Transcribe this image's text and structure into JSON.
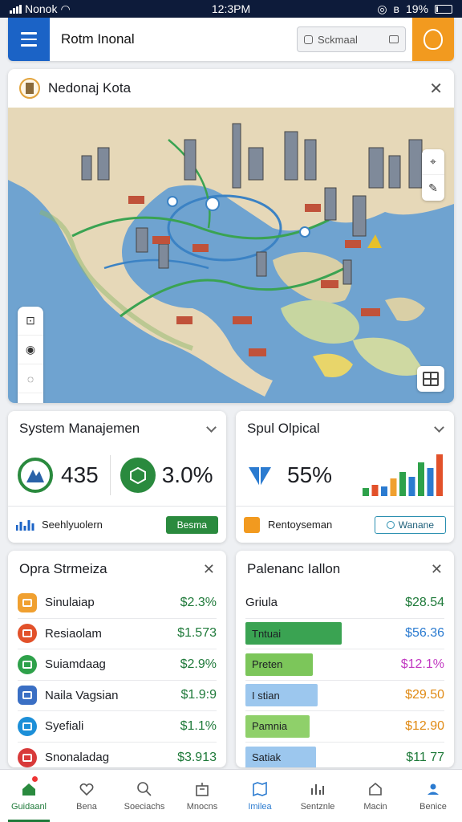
{
  "status": {
    "carrier": "Nonok",
    "time": "12:3PM",
    "battery": "19%"
  },
  "app": {
    "title": "Rotm Inonal",
    "search_placeholder": "Sckmaal"
  },
  "map": {
    "title": "Nedonaj Kota"
  },
  "colors": {
    "primary": "#1b63c6",
    "accent": "#f29a1f",
    "green": "#1f7a3a",
    "water": "#6fa3d0",
    "land": "#e8dcc0"
  },
  "card_system": {
    "title": "System Manajemen",
    "stat1": "435",
    "stat2": "3.0%",
    "footer_label": "Seehlyuolern",
    "footer_button": "Besma"
  },
  "card_spul": {
    "title": "Spul Olpical",
    "stat": "55%",
    "footer_label": "Rentoyseman",
    "footer_button": "Wanane",
    "chart_values": [
      10,
      14,
      12,
      22,
      30,
      24,
      42,
      35,
      52
    ]
  },
  "list_left": {
    "title": "Opra Strmeiza",
    "items": [
      {
        "label": "Sinulaiap",
        "value": "$2.3%",
        "icon": "folder-icon",
        "color": "#f0a030"
      },
      {
        "label": "Resiaolam",
        "value": "$1.573",
        "icon": "gear-icon",
        "color": "#e2512a"
      },
      {
        "label": "Suiamdaag",
        "value": "$2.9%",
        "icon": "grid-icon",
        "color": "#2ea14a"
      },
      {
        "label": "Naila Vagsian",
        "value": "$1.9:9",
        "icon": "box-icon",
        "color": "#3a6fc4"
      },
      {
        "label": "Syefiali",
        "value": "$1.1%",
        "icon": "globe-icon",
        "color": "#1c8fd8"
      },
      {
        "label": "Snonaladag",
        "value": "$3.913",
        "icon": "document-icon",
        "color": "#d83a3a"
      }
    ]
  },
  "list_right": {
    "title": "Palenanc Iallon",
    "header_label": "Griula",
    "header_value": "$28.54",
    "items": [
      {
        "label": "Tntuai",
        "value": "$56.36",
        "fill": 0.6,
        "bar_color": "#3aa352",
        "value_color": "#2b7bd0"
      },
      {
        "label": "Preten",
        "value": "$12.1%",
        "fill": 0.42,
        "bar_color": "#7cc65a",
        "value_color": "#c23ac2"
      },
      {
        "label": "I stian",
        "value": "$29.50",
        "fill": 0.45,
        "bar_color": "#9cc7ee",
        "value_color": "#e08a14"
      },
      {
        "label": "Pamnia",
        "value": "$12.90",
        "fill": 0.4,
        "bar_color": "#8fd06a",
        "value_color": "#e08a14"
      },
      {
        "label": "Satiak",
        "value": "$11 77",
        "fill": 0.44,
        "bar_color": "#9cc7ee",
        "value_color": "#1f7a3a"
      }
    ]
  },
  "nav": [
    {
      "label": "Guidaanl",
      "icon": "home-icon",
      "active": true
    },
    {
      "label": "Bena",
      "icon": "heart-icon",
      "active": false
    },
    {
      "label": "Soeciachs",
      "icon": "search-icon",
      "active": false
    },
    {
      "label": "Mnocns",
      "icon": "building-icon",
      "active": false
    },
    {
      "label": "Imilea",
      "icon": "map-icon",
      "active": false
    },
    {
      "label": "Sentznle",
      "icon": "chart-icon",
      "active": false
    },
    {
      "label": "Macin",
      "icon": "house-icon",
      "active": false
    },
    {
      "label": "Benice",
      "icon": "user-icon",
      "active": false
    }
  ]
}
